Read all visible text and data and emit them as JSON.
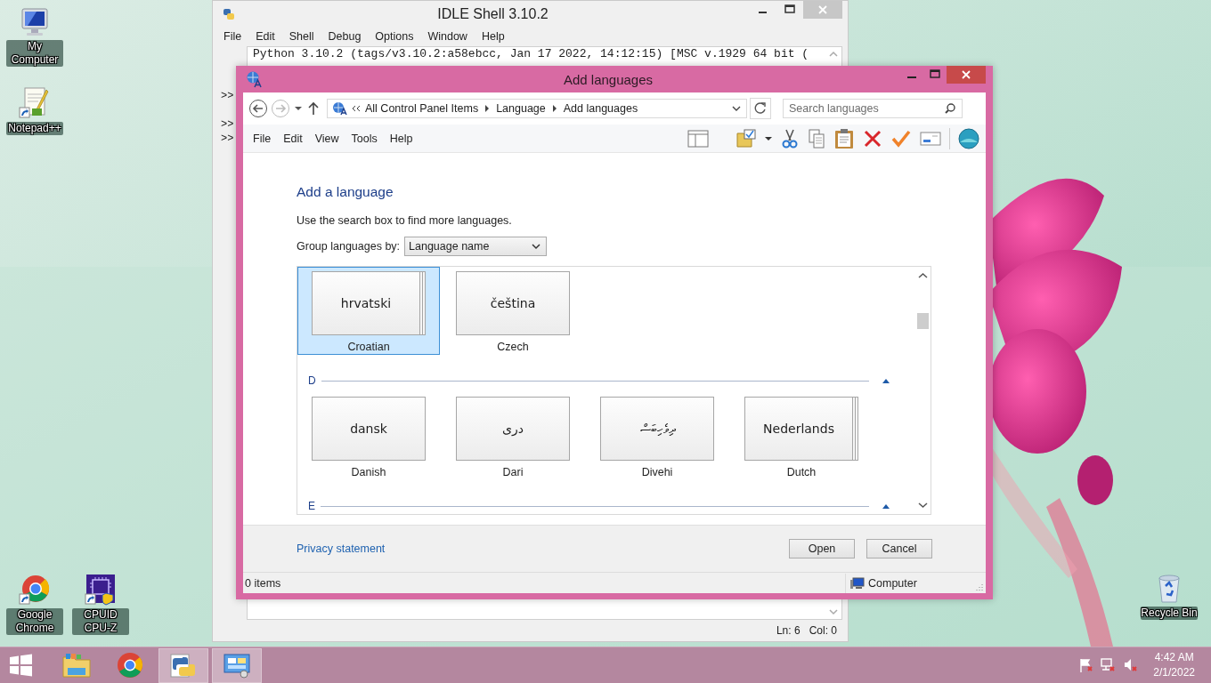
{
  "desktop_icons": [
    {
      "label": "My Computer",
      "kind": "computer"
    },
    {
      "label": "Notepad++",
      "kind": "notepad"
    },
    {
      "label": "Google Chrome",
      "kind": "chrome"
    },
    {
      "label": "CPUID CPU-Z",
      "kind": "cpuz"
    },
    {
      "label": "Recycle Bin",
      "kind": "recycle"
    }
  ],
  "idle_window": {
    "title": "IDLE Shell 3.10.2",
    "menu": [
      "File",
      "Edit",
      "Shell",
      "Debug",
      "Options",
      "Window",
      "Help"
    ],
    "output_line": "Python 3.10.2 (tags/v3.10.2:a58ebcc, Jan 17 2022, 14:12:15) [MSC v.1929 64 bit (",
    "prompts": [
      ">>",
      ">>",
      ">>"
    ],
    "status": [
      "Ln: 6",
      "Col: 0"
    ]
  },
  "dialog": {
    "title": "Add languages",
    "breadcrumb": [
      "All Control Panel Items",
      "Language",
      "Add languages"
    ],
    "search": {
      "placeholder": "Search languages"
    },
    "menu": [
      "File",
      "Edit",
      "View",
      "Tools",
      "Help"
    ],
    "heading": "Add a language",
    "hint": "Use the search box to find more languages.",
    "group_by": {
      "label": "Group languages by:",
      "value": "Language name"
    },
    "groups": [
      {
        "languages": [
          {
            "native": "hrvatski",
            "name": "Croatian",
            "stacked": true,
            "selected": true
          },
          {
            "native": "čeština",
            "name": "Czech",
            "stacked": false,
            "selected": false
          }
        ]
      },
      {
        "header": "D",
        "languages": [
          {
            "native": "dansk",
            "name": "Danish",
            "stacked": false,
            "selected": false
          },
          {
            "native": "دری",
            "name": "Dari",
            "stacked": false,
            "selected": false
          },
          {
            "native": "ދިވެހިބަސް",
            "name": "Divehi",
            "stacked": false,
            "selected": false
          },
          {
            "native": "Nederlands",
            "name": "Dutch",
            "stacked": true,
            "selected": false
          }
        ]
      },
      {
        "header": "E"
      }
    ],
    "privacy_link": "Privacy statement",
    "buttons": [
      "Open",
      "Cancel"
    ],
    "status": {
      "items": "0 items",
      "location": "Computer"
    }
  },
  "taskbar": {
    "apps": [
      {
        "kind": "explorer",
        "active": false
      },
      {
        "kind": "chrome",
        "active": false
      },
      {
        "kind": "python",
        "active": true
      },
      {
        "kind": "control-panel",
        "active": true
      }
    ],
    "time": "4:42 AM",
    "date": "2/1/2022"
  }
}
